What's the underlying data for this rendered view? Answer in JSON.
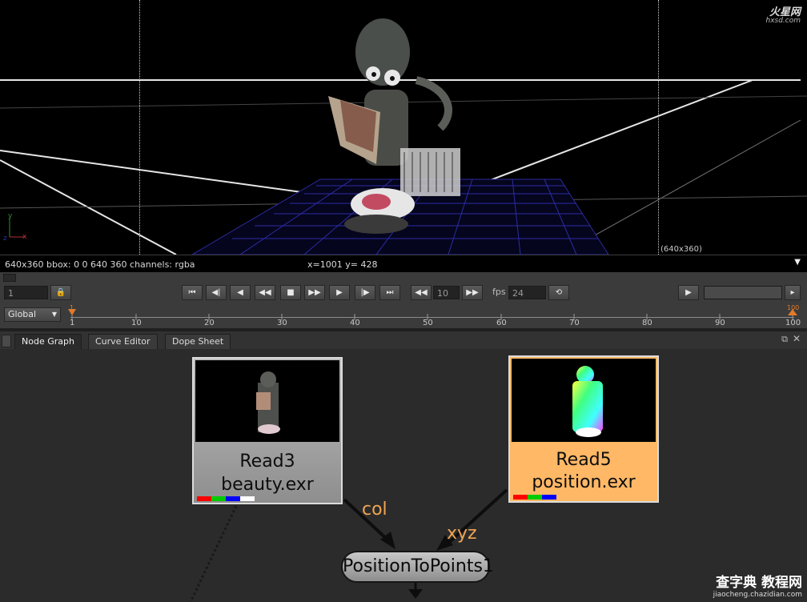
{
  "viewer": {
    "watermark_main": "火星网",
    "watermark_sub": "hxsd.com",
    "format_label": "(640x360)",
    "info_left": "640x360 bbox: 0 0 640 360 channels: rgba",
    "info_center": "x=1001 y= 428",
    "menu_icon": "triangle-down-icon"
  },
  "transport": {
    "frame_value": "1",
    "skip_value": "10",
    "fps_label": "fps",
    "fps_value": "24",
    "buttons": [
      "first-frame-icon",
      "prev-keyframe-icon",
      "step-back-icon",
      "play-backward-icon",
      "stop-icon",
      "play-forward-icon",
      "step-forward-icon",
      "next-keyframe-icon",
      "last-frame-icon"
    ]
  },
  "timeline": {
    "range_select": "Global",
    "start_marker": "1",
    "end_marker": "100",
    "ticks": [
      "1",
      "10",
      "20",
      "30",
      "40",
      "50",
      "60",
      "70",
      "80",
      "90",
      "100"
    ]
  },
  "tabs": [
    "Node Graph",
    "Curve Editor",
    "Dope Sheet"
  ],
  "nodes": {
    "read3": {
      "name": "Read3",
      "file": "beauty.exr",
      "channels": [
        "#ff0000",
        "#00cc00",
        "#0000ff",
        "#ffffff"
      ]
    },
    "read5": {
      "name": "Read5",
      "file": "position.exr",
      "channels": [
        "#ff0000",
        "#00cc00",
        "#0000ff"
      ]
    },
    "ptp": {
      "name": "PositionToPoints1"
    },
    "edge_col": "col",
    "edge_xyz": "xyz"
  },
  "corner_watermark": {
    "main": "查字典 教程网",
    "url": "jiaocheng.chazidian.com"
  },
  "colors": {
    "accent_orange": "#f0a552",
    "selected_node": "#ffb866",
    "read_node": "#9a9a9a"
  }
}
